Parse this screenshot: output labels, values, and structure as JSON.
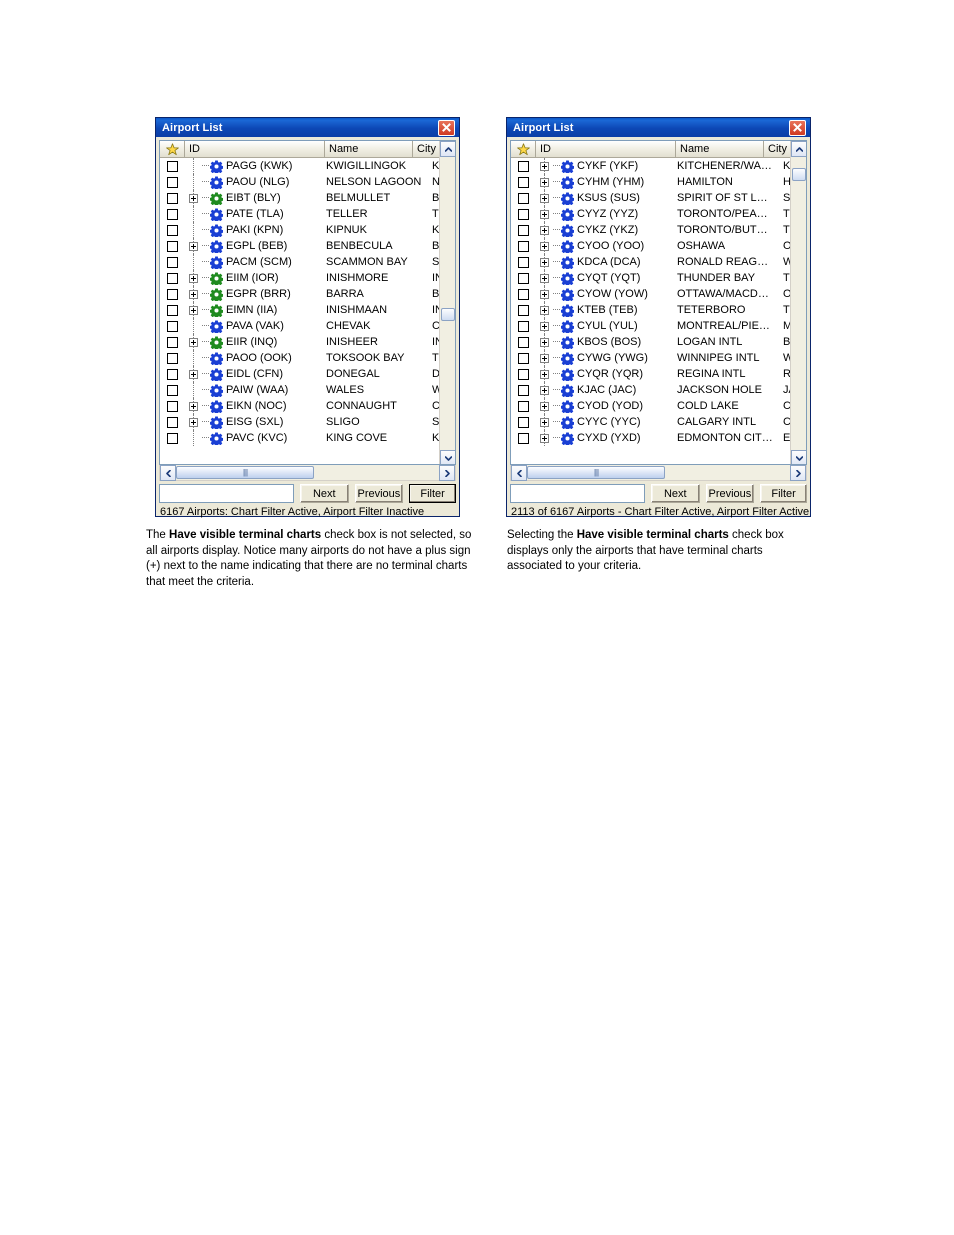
{
  "panels": [
    {
      "id": "left",
      "title": "Airport List",
      "close_label": "Close",
      "columns": {
        "star": "star-icon",
        "id": "ID",
        "name": "Name",
        "city": "City"
      },
      "rows": [
        {
          "checked": false,
          "expandable": false,
          "gear": "blue",
          "id": "PAGG (KWK)",
          "name": "KWIGILLINGOK",
          "city": "KWIGILLI"
        },
        {
          "checked": false,
          "expandable": false,
          "gear": "blue",
          "id": "PAOU (NLG)",
          "name": "NELSON LAGOON",
          "city": "NELSON L"
        },
        {
          "checked": false,
          "expandable": true,
          "gear": "green",
          "id": "EIBT (BLY)",
          "name": "BELMULLET",
          "city": "BELMULLE"
        },
        {
          "checked": false,
          "expandable": false,
          "gear": "blue",
          "id": "PATE (TLA)",
          "name": "TELLER",
          "city": "TELLER"
        },
        {
          "checked": false,
          "expandable": false,
          "gear": "blue",
          "id": "PAKI (KPN)",
          "name": "KIPNUK",
          "city": "KIPNUK"
        },
        {
          "checked": false,
          "expandable": true,
          "gear": "blue",
          "id": "EGPL (BEB)",
          "name": "BENBECULA",
          "city": "BENBECU"
        },
        {
          "checked": false,
          "expandable": false,
          "gear": "blue",
          "id": "PACM (SCM)",
          "name": "SCAMMON BAY",
          "city": "SCAMMO"
        },
        {
          "checked": false,
          "expandable": true,
          "gear": "green",
          "id": "EIIM (IOR)",
          "name": "INISHMORE",
          "city": "INISHMO"
        },
        {
          "checked": false,
          "expandable": true,
          "gear": "green",
          "id": "EGPR (BRR)",
          "name": "BARRA",
          "city": "BARRA"
        },
        {
          "checked": false,
          "expandable": true,
          "gear": "green",
          "id": "EIMN (IIA)",
          "name": "INISHMAAN",
          "city": "INISHMA"
        },
        {
          "checked": false,
          "expandable": false,
          "gear": "blue",
          "id": "PAVA (VAK)",
          "name": "CHEVAK",
          "city": "CHEVAK"
        },
        {
          "checked": false,
          "expandable": true,
          "gear": "green",
          "id": "EIIR (INQ)",
          "name": "INISHEER",
          "city": "INISHEER"
        },
        {
          "checked": false,
          "expandable": false,
          "gear": "blue",
          "id": "PAOO (OOK)",
          "name": "TOKSOOK BAY",
          "city": "TOKSOO"
        },
        {
          "checked": false,
          "expandable": true,
          "gear": "blue",
          "id": "EIDL (CFN)",
          "name": "DONEGAL",
          "city": "DONEGAL"
        },
        {
          "checked": false,
          "expandable": false,
          "gear": "blue",
          "id": "PAIW (WAA)",
          "name": "WALES",
          "city": "WALES"
        },
        {
          "checked": false,
          "expandable": true,
          "gear": "blue",
          "id": "EIKN (NOC)",
          "name": "CONNAUGHT",
          "city": "CONNAU"
        },
        {
          "checked": false,
          "expandable": true,
          "gear": "blue",
          "id": "EISG (SXL)",
          "name": "SLIGO",
          "city": "SLIGO"
        },
        {
          "checked": false,
          "expandable": false,
          "gear": "blue",
          "id": "PAVC (KVC)",
          "name": "KING COVE",
          "city": "KING COV"
        }
      ],
      "search_value": "",
      "search_placeholder": "",
      "buttons": {
        "next": "Next",
        "previous": "Previous",
        "filter": "Filter"
      },
      "status": "6167 Airports: Chart Filter Active, Airport Filter Inactive",
      "vscroll_thumb_top_pct": 54,
      "caption_html": "The <b>Have visible terminal charts</b> check box is not selected, so all airports display. Notice many airports do not have a plus sign (+) next to the name indicating that there are no terminal charts that meet the criteria."
    },
    {
      "id": "right",
      "title": "Airport List",
      "close_label": "Close",
      "columns": {
        "star": "star-icon",
        "id": "ID",
        "name": "Name",
        "city": "City"
      },
      "rows": [
        {
          "checked": false,
          "expandable": true,
          "gear": "blue",
          "id": "CYKF (YKF)",
          "name": "KITCHENER/WA…",
          "city": "KITCHENI"
        },
        {
          "checked": false,
          "expandable": true,
          "gear": "blue",
          "id": "CYHM (YHM)",
          "name": "HAMILTON",
          "city": "HAMILTO"
        },
        {
          "checked": false,
          "expandable": true,
          "gear": "blue",
          "id": "KSUS (SUS)",
          "name": "SPIRIT OF ST L…",
          "city": "ST LOUIS"
        },
        {
          "checked": false,
          "expandable": true,
          "gear": "blue",
          "id": "CYYZ (YYZ)",
          "name": "TORONTO/PEA…",
          "city": "TORONT("
        },
        {
          "checked": false,
          "expandable": true,
          "gear": "blue",
          "id": "CYKZ (YKZ)",
          "name": "TORONTO/BUT…",
          "city": "TORONT("
        },
        {
          "checked": false,
          "expandable": true,
          "gear": "blue",
          "id": "CYOO (YOO)",
          "name": "OSHAWA",
          "city": "OSHAWA"
        },
        {
          "checked": false,
          "expandable": true,
          "gear": "blue",
          "id": "KDCA (DCA)",
          "name": "RONALD REAG…",
          "city": "WASHIN("
        },
        {
          "checked": false,
          "expandable": true,
          "gear": "blue",
          "id": "CYQT (YQT)",
          "name": "THUNDER BAY",
          "city": "THUNDER"
        },
        {
          "checked": false,
          "expandable": true,
          "gear": "blue",
          "id": "CYOW (YOW)",
          "name": "OTTAWA/MACD…",
          "city": "OTTAWA"
        },
        {
          "checked": false,
          "expandable": true,
          "gear": "blue",
          "id": "KTEB (TEB)",
          "name": "TETERBORO",
          "city": "TETERBO"
        },
        {
          "checked": false,
          "expandable": true,
          "gear": "blue",
          "id": "CYUL (YUL)",
          "name": "MONTREAL/PIE…",
          "city": "MONTRE/"
        },
        {
          "checked": false,
          "expandable": true,
          "gear": "blue",
          "id": "KBOS (BOS)",
          "name": "LOGAN INTL",
          "city": "BOSTON"
        },
        {
          "checked": false,
          "expandable": true,
          "gear": "blue",
          "id": "CYWG (YWG)",
          "name": "WINNIPEG INTL",
          "city": "WINNIPE"
        },
        {
          "checked": false,
          "expandable": true,
          "gear": "blue",
          "id": "CYQR (YQR)",
          "name": "REGINA INTL",
          "city": "REGINA"
        },
        {
          "checked": false,
          "expandable": true,
          "gear": "blue",
          "id": "KJAC (JAC)",
          "name": "JACKSON HOLE",
          "city": "JACKSON"
        },
        {
          "checked": false,
          "expandable": true,
          "gear": "blue",
          "id": "CYOD (YOD)",
          "name": "COLD LAKE",
          "city": "COLD LAI"
        },
        {
          "checked": false,
          "expandable": true,
          "gear": "blue",
          "id": "CYYC (YYC)",
          "name": "CALGARY INTL",
          "city": "CALGARY"
        },
        {
          "checked": false,
          "expandable": true,
          "gear": "blue",
          "id": "CYXD (YXD)",
          "name": "EDMONTON CIT…",
          "city": "EDMONT("
        }
      ],
      "search_value": "",
      "search_placeholder": "",
      "buttons": {
        "next": "Next",
        "previous": "Previous",
        "filter": "Filter"
      },
      "status": "2113 of 6167 Airports - Chart Filter Active, Airport Filter Active",
      "vscroll_thumb_top_pct": 4,
      "caption_html": "Selecting the <b>Have visible terminal charts</b> check box displays only the airports that have terminal charts associated to your criteria."
    }
  ],
  "colors": {
    "titlebar": "#0b47b0",
    "gear_blue": "#1a3fd4",
    "gear_green": "#1f8b1f",
    "close_red": "#cf3a22",
    "dialog_face": "#ece9d8",
    "grid_border": "#7f9db9"
  }
}
